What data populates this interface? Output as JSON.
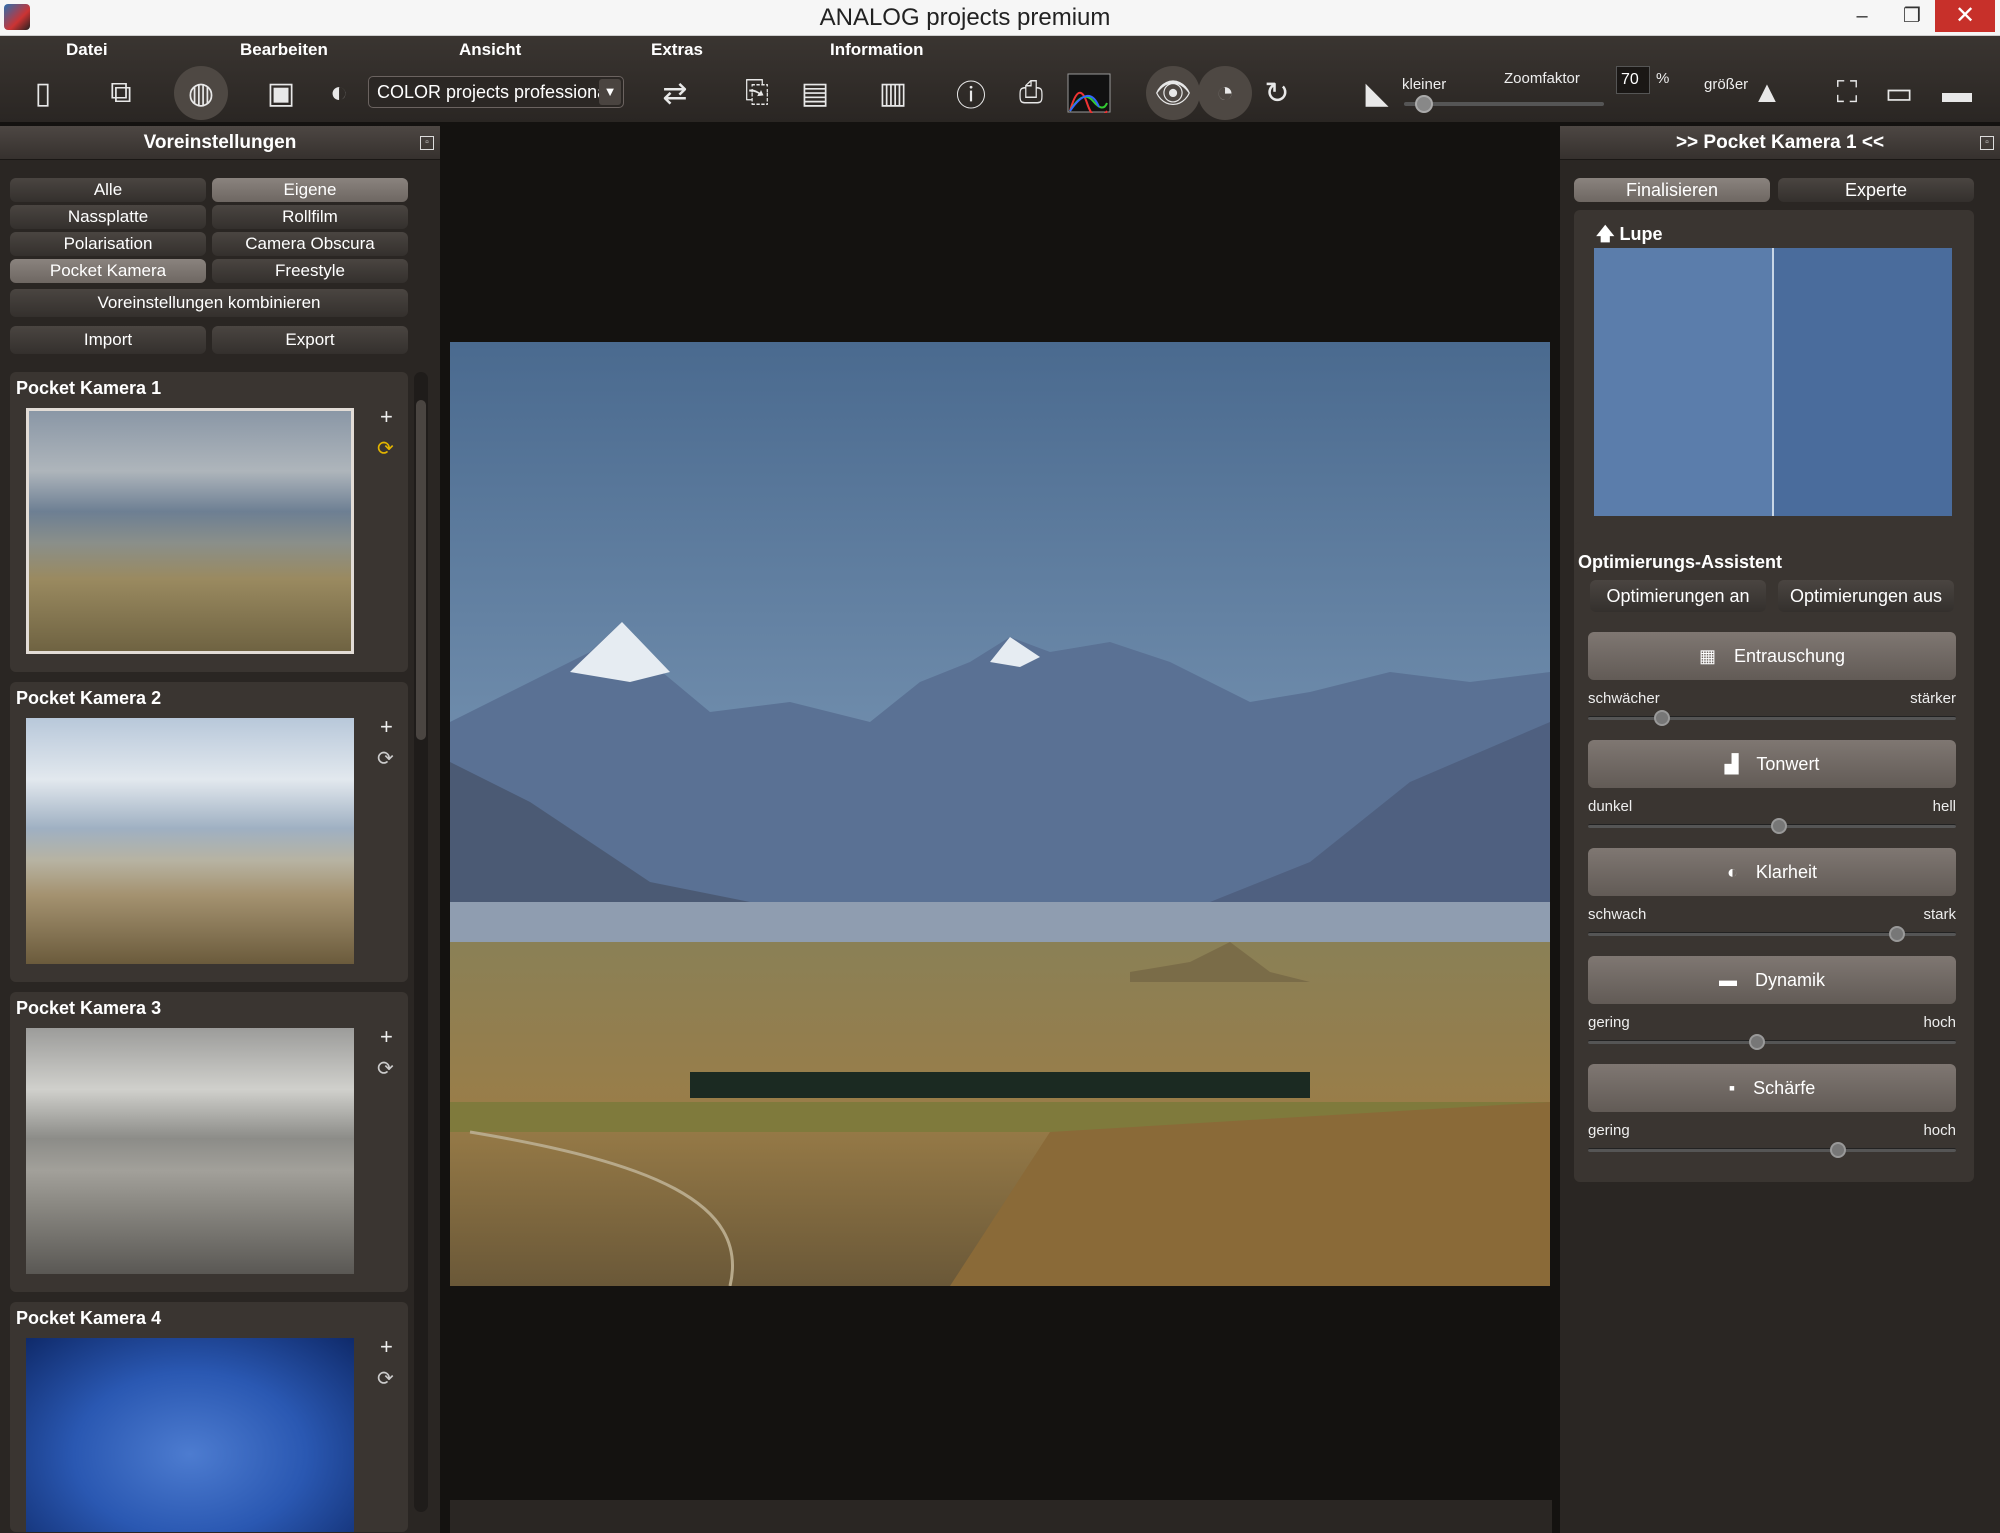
{
  "window": {
    "title": "ANALOG projects premium",
    "minimize": "–",
    "maximize": "❐",
    "close": "✕"
  },
  "menu": [
    "Datei",
    "Bearbeiten",
    "Ansicht",
    "Extras",
    "Information"
  ],
  "toolbar": {
    "preset_value": "COLOR projects professional",
    "zoom_label": "Zoomfaktor",
    "zoom_value": "70",
    "zoom_unit": "%",
    "smaller": "kleiner",
    "larger": "größer",
    "zoom_level": 0.1
  },
  "left_panel": {
    "title": "Voreinstellungen",
    "filters": [
      "Alle",
      "Eigene",
      "Nassplatte",
      "Rollfilm",
      "Polarisation",
      "Camera Obscura",
      "Pocket Kamera",
      "Freestyle"
    ],
    "active_filters": [
      "Eigene",
      "Pocket Kamera"
    ],
    "combine": "Voreinstellungen kombinieren",
    "import": "Import",
    "export": "Export",
    "presets": [
      "Pocket Kamera 1",
      "Pocket Kamera 2",
      "Pocket Kamera 3",
      "Pocket Kamera 4"
    ]
  },
  "right_panel": {
    "title": ">> Pocket Kamera 1 <<",
    "tab_finalize": "Finalisieren",
    "tab_expert": "Experte",
    "loupe": "Lupe",
    "assistant_title": "Optimierungs-Assistent",
    "opt_on": "Optimierungen an",
    "opt_off": "Optimierungen aus",
    "controls": [
      {
        "label": "Entrauschung",
        "min": "schwächer",
        "max": "stärker",
        "value": 0.2
      },
      {
        "label": "Tonwert",
        "min": "dunkel",
        "max": "hell",
        "value": 0.52
      },
      {
        "label": "Klarheit",
        "min": "schwach",
        "max": "stark",
        "value": 0.84
      },
      {
        "label": "Dynamik",
        "min": "gering",
        "max": "hoch",
        "value": 0.46
      },
      {
        "label": "Schärfe",
        "min": "gering",
        "max": "hoch",
        "value": 0.68
      }
    ]
  },
  "icons": {
    "new_doc": "new-document-icon",
    "eye": "eye-icon",
    "exif": "EXIF"
  }
}
